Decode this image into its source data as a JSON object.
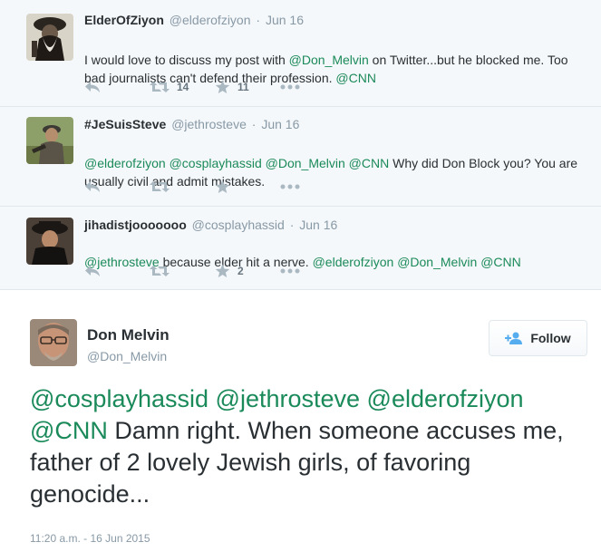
{
  "colors": {
    "mention": "#1b8a5a",
    "muted": "#8899a6",
    "action_icon": "#aab8c2",
    "reply_bg": "#f5f8fa"
  },
  "replies": [
    {
      "fullname": "ElderOfZiyon",
      "username": "@elderofziyon",
      "sep": "·",
      "time": "Jun 16",
      "text_parts": [
        {
          "text": "I would love to discuss my post with ",
          "mention": false
        },
        {
          "text": "@Don_Melvin",
          "mention": true
        },
        {
          "text": " on Twitter...but he blocked me.  Too bad journalists can't defend their profession. ",
          "mention": false
        },
        {
          "text": "@CNN",
          "mention": true
        }
      ],
      "retweet_count": "14",
      "favorite_count": "11",
      "icons": [
        "reply-icon",
        "retweet-icon",
        "favorite-icon",
        "more-icon"
      ]
    },
    {
      "fullname": "#JeSuisSteve",
      "username": "@jethrosteve",
      "sep": "·",
      "time": "Jun 16",
      "text_parts": [
        {
          "text": "@elderofziyon",
          "mention": true
        },
        {
          "text": " ",
          "mention": false
        },
        {
          "text": "@cosplayhassid",
          "mention": true
        },
        {
          "text": " ",
          "mention": false
        },
        {
          "text": "@Don_Melvin",
          "mention": true
        },
        {
          "text": " ",
          "mention": false
        },
        {
          "text": "@CNN",
          "mention": true
        },
        {
          "text": " Why did Don Block you? You are usually civil and admit mistakes.",
          "mention": false
        }
      ],
      "retweet_count": "",
      "favorite_count": "",
      "icons": [
        "reply-icon",
        "retweet-icon",
        "favorite-icon",
        "more-icon"
      ]
    },
    {
      "fullname": "jihadistjooooooo",
      "username": "@cosplayhassid",
      "sep": "·",
      "time": "Jun 16",
      "text_parts": [
        {
          "text": "@jethrosteve",
          "mention": true
        },
        {
          "text": " because elder hit a nerve. ",
          "mention": false
        },
        {
          "text": "@elderofziyon",
          "mention": true
        },
        {
          "text": " ",
          "mention": false
        },
        {
          "text": "@Don_Melvin",
          "mention": true
        },
        {
          "text": " ",
          "mention": false
        },
        {
          "text": "@CNN",
          "mention": true
        }
      ],
      "retweet_count": "",
      "favorite_count": "2",
      "icons": [
        "reply-icon",
        "retweet-icon",
        "favorite-icon",
        "more-icon"
      ]
    }
  ],
  "main": {
    "fullname": "Don Melvin",
    "username": "@Don_Melvin",
    "follow_label": "Follow",
    "follow_icon": "add-user-icon",
    "text_parts": [
      {
        "text": "@cosplayhassid",
        "mention": true
      },
      {
        "text": " ",
        "mention": false
      },
      {
        "text": "@jethrosteve",
        "mention": true
      },
      {
        "text": " ",
        "mention": false
      },
      {
        "text": "@elderofziyon",
        "mention": true
      },
      {
        "text": " ",
        "mention": false
      },
      {
        "text": "@CNN",
        "mention": true
      },
      {
        "text": " Damn right. When someone accuses me, father of 2 lovely Jewish girls, of favoring genocide...",
        "mention": false
      }
    ],
    "timestamp": "11:20 a.m. - 16 Jun 2015"
  }
}
